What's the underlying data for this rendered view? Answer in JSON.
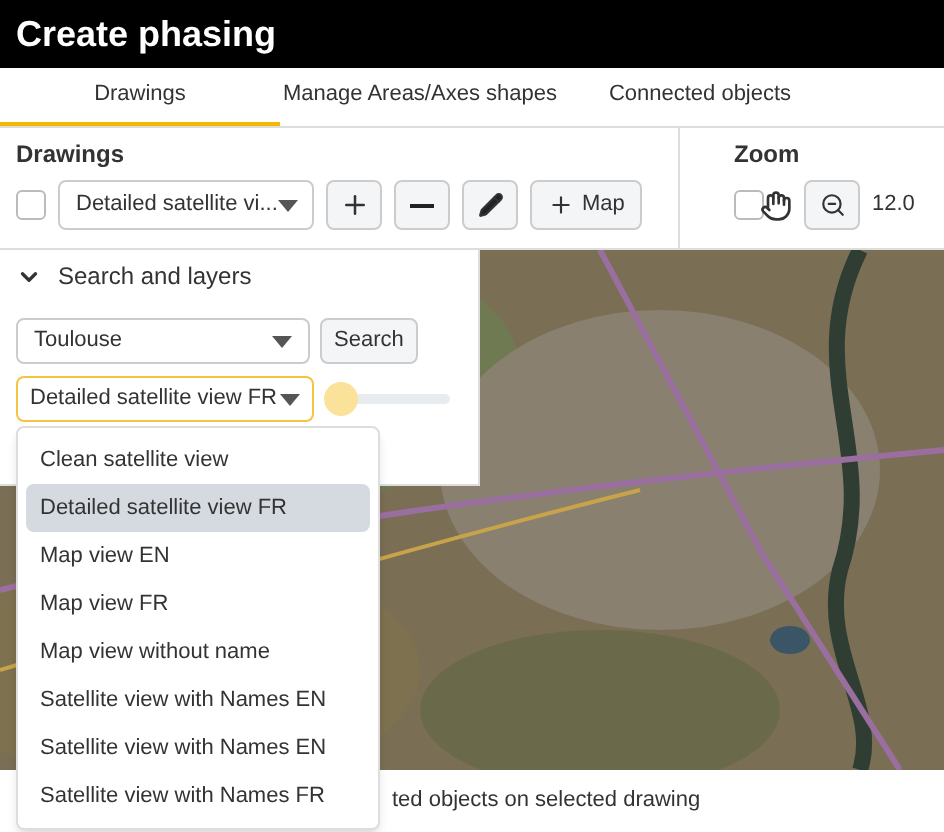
{
  "window": {
    "title": "Create phasing"
  },
  "tabs": [
    {
      "label": "Drawings",
      "selected": true
    },
    {
      "label": "Manage Areas/Axes shapes",
      "selected": false
    },
    {
      "label": "Connected objects",
      "selected": false
    }
  ],
  "drawings": {
    "heading": "Drawings",
    "checked": false,
    "select_value": "Detailed satellite vi...",
    "map_button": "Map"
  },
  "zoom": {
    "heading": "Zoom",
    "pan_checked": false,
    "value": "12.0"
  },
  "search_panel": {
    "title": "Search and layers",
    "expanded": true,
    "location": "Toulouse",
    "search_button": "Search",
    "layer_value": "Detailed satellite view FR",
    "opacity": {
      "level": 0
    }
  },
  "layer_options": [
    {
      "label": "Clean satellite view",
      "selected": false
    },
    {
      "label": "Detailed satellite view FR",
      "selected": true
    },
    {
      "label": "Map view EN",
      "selected": false
    },
    {
      "label": "Map view FR",
      "selected": false
    },
    {
      "label": "Map view without name",
      "selected": false
    },
    {
      "label": "Satellite view with Names EN",
      "selected": false
    },
    {
      "label": "Satellite view with Names EN",
      "selected": false
    },
    {
      "label": "Satellite view with Names FR",
      "selected": false
    }
  ],
  "status_text": "ted objects on selected drawing"
}
